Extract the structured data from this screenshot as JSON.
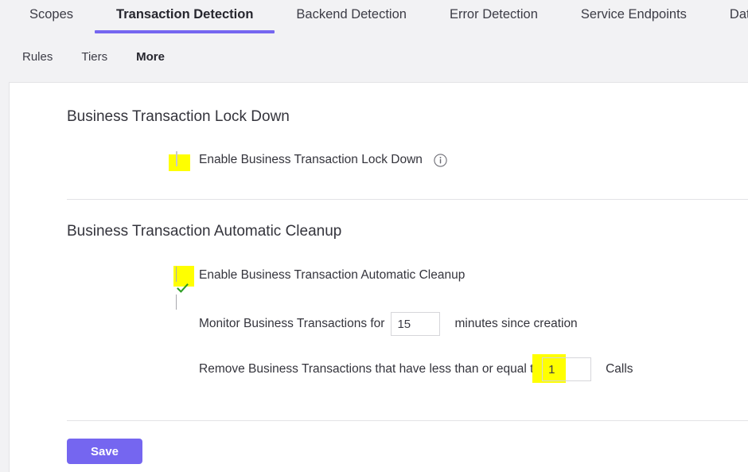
{
  "primary_tabs": [
    {
      "label": "Scopes",
      "active": false
    },
    {
      "label": "Transaction Detection",
      "active": true
    },
    {
      "label": "Backend Detection",
      "active": false
    },
    {
      "label": "Error Detection",
      "active": false
    },
    {
      "label": "Service Endpoints",
      "active": false
    },
    {
      "label": "Data Collect",
      "active": false
    }
  ],
  "secondary_tabs": [
    {
      "label": "Rules",
      "active": false
    },
    {
      "label": "Tiers",
      "active": false
    },
    {
      "label": "More",
      "active": true
    }
  ],
  "lock_down": {
    "title": "Business Transaction Lock Down",
    "checkbox_label": "Enable Business Transaction Lock Down",
    "checked": false,
    "info_icon": "info-icon",
    "highlighted": true
  },
  "auto_cleanup": {
    "title": "Business Transaction Automatic Cleanup",
    "checkbox_label": "Enable Business Transaction Automatic Cleanup",
    "checked": true,
    "highlighted": true,
    "monitor_row": {
      "label_before": "Monitor Business Transactions for",
      "value": "15",
      "placeholder": "",
      "label_after": "minutes since creation"
    },
    "remove_row": {
      "label_before": "Remove Business Transactions that have less than or equal to",
      "value": "1",
      "placeholder": "",
      "label_after": "Calls",
      "highlighted": true
    }
  },
  "actions": {
    "save_label": "Save"
  },
  "colors": {
    "accent": "#7566f0",
    "highlight": "#ffff00",
    "check": "#2a9d23",
    "page_bg": "#f2f2f4",
    "card_bg": "#ffffff",
    "text": "#34343c"
  }
}
